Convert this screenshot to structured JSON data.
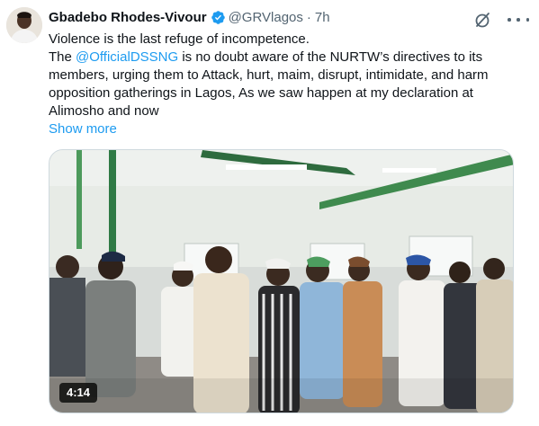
{
  "author": {
    "display_name": "Gbadebo Rhodes-Vivour",
    "handle": "@GRVlagos",
    "separator": "·",
    "time": "7h",
    "verified": true,
    "verified_color": "#1d9bf0"
  },
  "tweet": {
    "line1": "Violence is the last refuge of incompetence.",
    "body_prefix": "The ",
    "mention": "@OfficialDSSNG",
    "body_suffix": " is no doubt aware of the NURTW’s directives to its members, urging them to Attack, hurt, maim, disrupt, intimidate, and harm opposition gatherings in Lagos, As we saw happen at my declaration at Alimosho and now",
    "show_more": "Show more"
  },
  "media": {
    "type": "video",
    "duration": "4:14"
  },
  "icons": {
    "grok": "grok-icon",
    "more": "more-options-icon",
    "verified": "verified-badge-icon"
  },
  "colors": {
    "link": "#1d9bf0",
    "text": "#0f1419",
    "secondary": "#536471"
  }
}
